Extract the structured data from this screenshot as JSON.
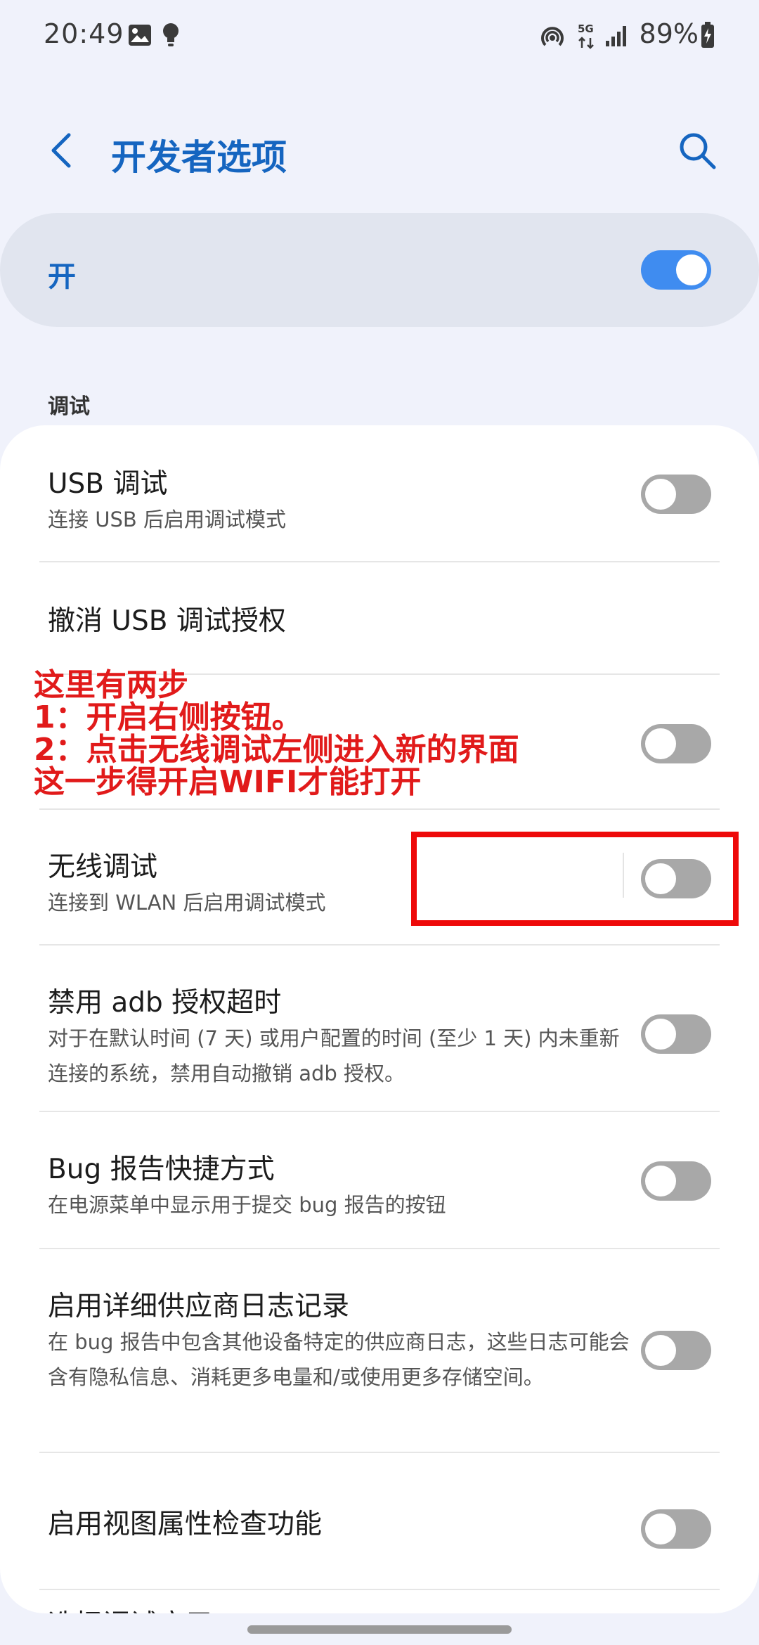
{
  "status_bar": {
    "time": "20:49",
    "battery": "89%",
    "network": "5G",
    "icons": [
      "gallery-icon",
      "lightbulb-icon",
      "hotspot-icon",
      "network-5g-icon",
      "signal-icon",
      "battery-charging-icon"
    ]
  },
  "header": {
    "title": "开发者选项",
    "back_icon": "chevron-left-icon",
    "search_icon": "search-icon"
  },
  "master": {
    "label": "开",
    "enabled": true
  },
  "section": {
    "title": "调试"
  },
  "rows": [
    {
      "title": "USB 调试",
      "subtitle": "连接 USB 后启用调试模式",
      "toggle": false
    },
    {
      "title": "撤消 USB 调试授权"
    },
    {
      "title": "",
      "toggle": false
    },
    {
      "title": "无线调试",
      "subtitle": "连接到 WLAN 后启用调试模式",
      "toggle": false
    },
    {
      "title": "禁用 adb 授权超时",
      "subtitle": "对于在默认时间 (7 天) 或用户配置的时间 (至少 1 天) 内未重新连接的系统，禁用自动撤销 adb 授权。",
      "toggle": false
    },
    {
      "title": "Bug 报告快捷方式",
      "subtitle": "在电源菜单中显示用于提交 bug 报告的按钮",
      "toggle": false
    },
    {
      "title": "启用详细供应商日志记录",
      "subtitle": "在 bug 报告中包含其他设备特定的供应商日志，这些日志可能会含有隐私信息、消耗更多电量和/或使用更多存储空间。",
      "toggle": false
    },
    {
      "title": "启用视图属性检查功能",
      "toggle": false
    },
    {
      "title": "选择调试应用"
    }
  ],
  "annotation": {
    "lines": [
      "这里有两步",
      "1：开启右侧按钮。",
      "2：点击无线调试左侧进入新的界面",
      "这一步得开启WIFI才能打开"
    ],
    "color": "#e11a1a"
  },
  "colors": {
    "accent": "#1565c0",
    "toggle_on": "#3f8cf0",
    "toggle_off": "#a8a8a8"
  }
}
